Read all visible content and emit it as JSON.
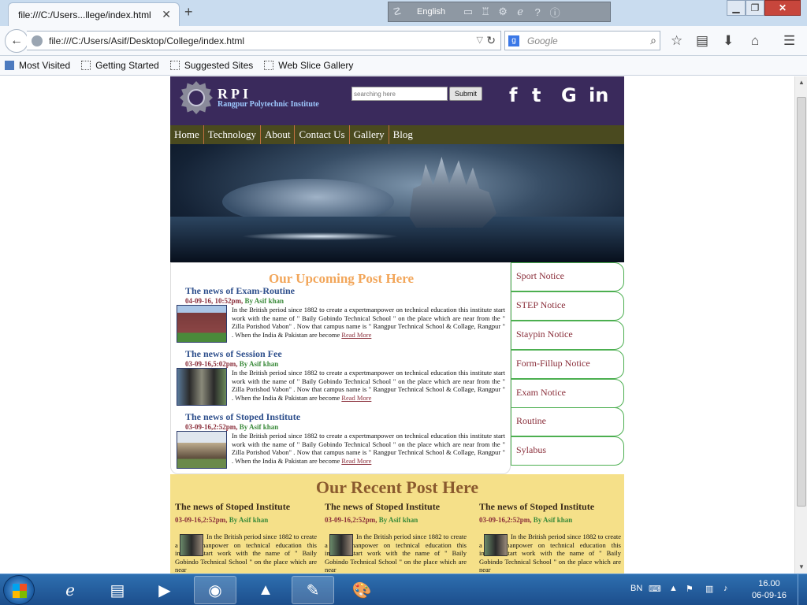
{
  "browser": {
    "tab_title": "file:///C:/Users...llege/index.html",
    "tab_close": "✕",
    "new_tab": "+",
    "language": "English",
    "url": "file:///C:/Users/Asif/Desktop/College/index.html",
    "search_placeholder": "Google",
    "bookmarks": [
      "Most Visited",
      "Getting Started",
      "Suggested Sites",
      "Web Slice Gallery"
    ]
  },
  "site": {
    "brand": "RPI",
    "brand_full": "Rangpur Polytechnic Institute",
    "search_placeholder": "searching here",
    "submit_label": "Submit",
    "social": [
      "f",
      "t",
      "G",
      "in"
    ],
    "menu": [
      "Home",
      "Technology",
      "About",
      "Contact Us",
      "Gallery",
      "Blog"
    ],
    "upcoming_title": "Our Upcoming Post Here",
    "posts": [
      {
        "title": "The news of Exam-Routine",
        "date": "04-09-16, 10:52pm,",
        "author": "By Asif khan",
        "text": "In the British period since 1882 to create a expertmanpower on technical education this institute start work with the name of \" Baily Gobindo Technical School \" on the place which are near from the \" Zilla Porishod Vabon\" . Now that campus name is \" Rangpur Technical School & Collage, Rangpur \" . When the India & Pakistan are become",
        "readmore": "Read More"
      },
      {
        "title": "The news of Session Fee",
        "date": "03-09-16,5:02pm,",
        "author": "By Asif khan",
        "text": "In the British period since 1882 to create a expertmanpower on technical education this institute start work with the name of \" Baily Gobindo Technical School \" on the place which are near from the \" Zilla Porishod Vabon\" . Now that campus name is \" Rangpur Technical School & Collage, Rangpur \" . When the India & Pakistan are become",
        "readmore": "Read More"
      },
      {
        "title": "The news of Stoped Institute",
        "date": "03-09-16,2:52pm,",
        "author": "By Asif khan",
        "text": "In the British period since 1882 to create a expertmanpower on technical education this institute start work with the name of \" Baily Gobindo Technical School \" on the place which are near from the \" Zilla Porishod Vabon\" . Now that campus name is \" Rangpur Technical School & Collage, Rangpur \" . When the India & Pakistan are become",
        "readmore": "Read More"
      }
    ],
    "sidebar": [
      "Sport Notice",
      "STEP Notice",
      "Staypin Notice",
      "Form-Fillup Notice",
      "Exam Notice",
      "Routine",
      "Sylabus"
    ],
    "recent_title": "Our Recent Post Here",
    "recent": [
      {
        "title": "The news of Stoped Institute",
        "date": "03-09-16,2:52pm,",
        "author": "By Asif khan",
        "text": "In the British period since 1882 to create a expertmanpower on technical education this institute start work with the name of \" Baily Gobindo Technical School \" on the place which are near"
      },
      {
        "title": "The news of Stoped Institute",
        "date": "03-09-16,2:52pm,",
        "author": "By Asif khan",
        "text": "In the British period since 1882 to create a expertmanpower on technical education this institute start work with the name of \" Baily Gobindo Technical School \" on the place which are near"
      },
      {
        "title": "The news of Stoped Institute",
        "date": "03-09-16,2:52pm,",
        "author": "By Asif khan",
        "text": "In the British period since 1882 to create a expertmanpower on technical education this institute start work with the name of \" Baily Gobindo Technical School \" on the place which are near"
      }
    ]
  },
  "taskbar": {
    "lang": "BN",
    "time": "16.00",
    "date": "06-09-16"
  }
}
